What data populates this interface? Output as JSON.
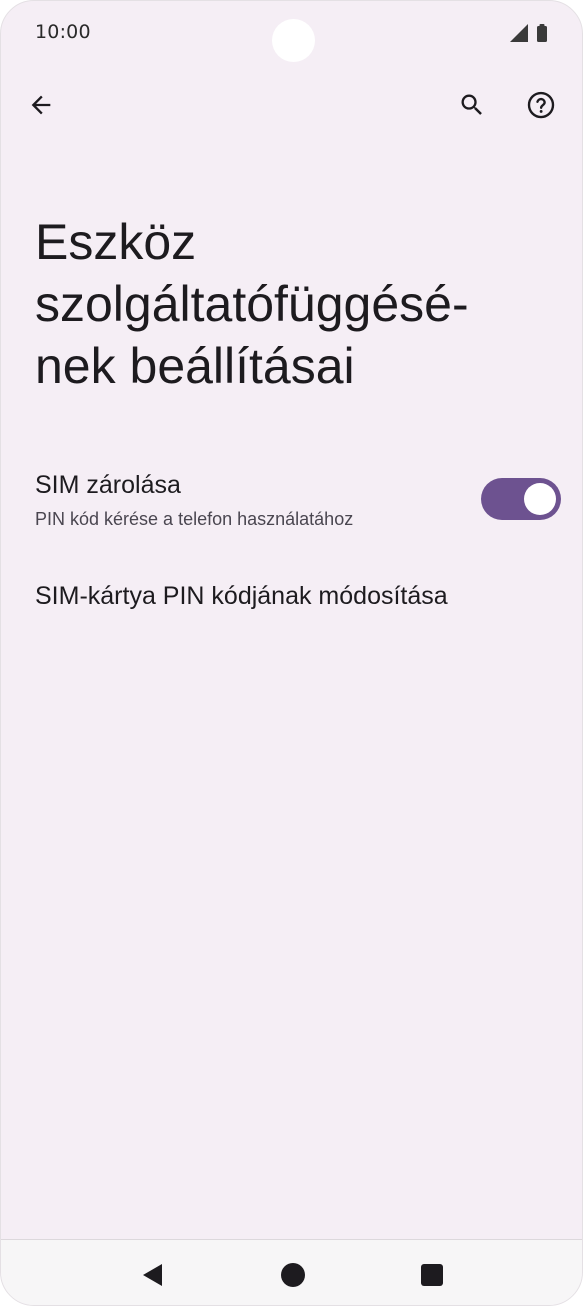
{
  "status_bar": {
    "time": "10:00",
    "icons": [
      "signal-icon",
      "battery-icon"
    ]
  },
  "app_bar": {
    "icons": [
      "back-arrow-icon",
      "search-icon",
      "help-icon"
    ]
  },
  "page": {
    "title_lines": [
      "Eszköz",
      "szolgáltatófüggésé-",
      "nek beállításai"
    ]
  },
  "settings": {
    "sim_lock": {
      "title": "SIM zárolása",
      "summary": "PIN kód kérése a telefon használatához",
      "enabled": true
    },
    "change_pin": {
      "title": "SIM-kártya PIN kódjának módosítása"
    }
  },
  "nav_bar": {
    "icons": [
      "nav-back-icon",
      "nav-home-icon",
      "nav-recents-icon"
    ]
  },
  "colors": {
    "background": "#f5eef5",
    "accent": "#6d5290",
    "text_primary": "#1d1b1f",
    "text_secondary": "#4a4650"
  }
}
